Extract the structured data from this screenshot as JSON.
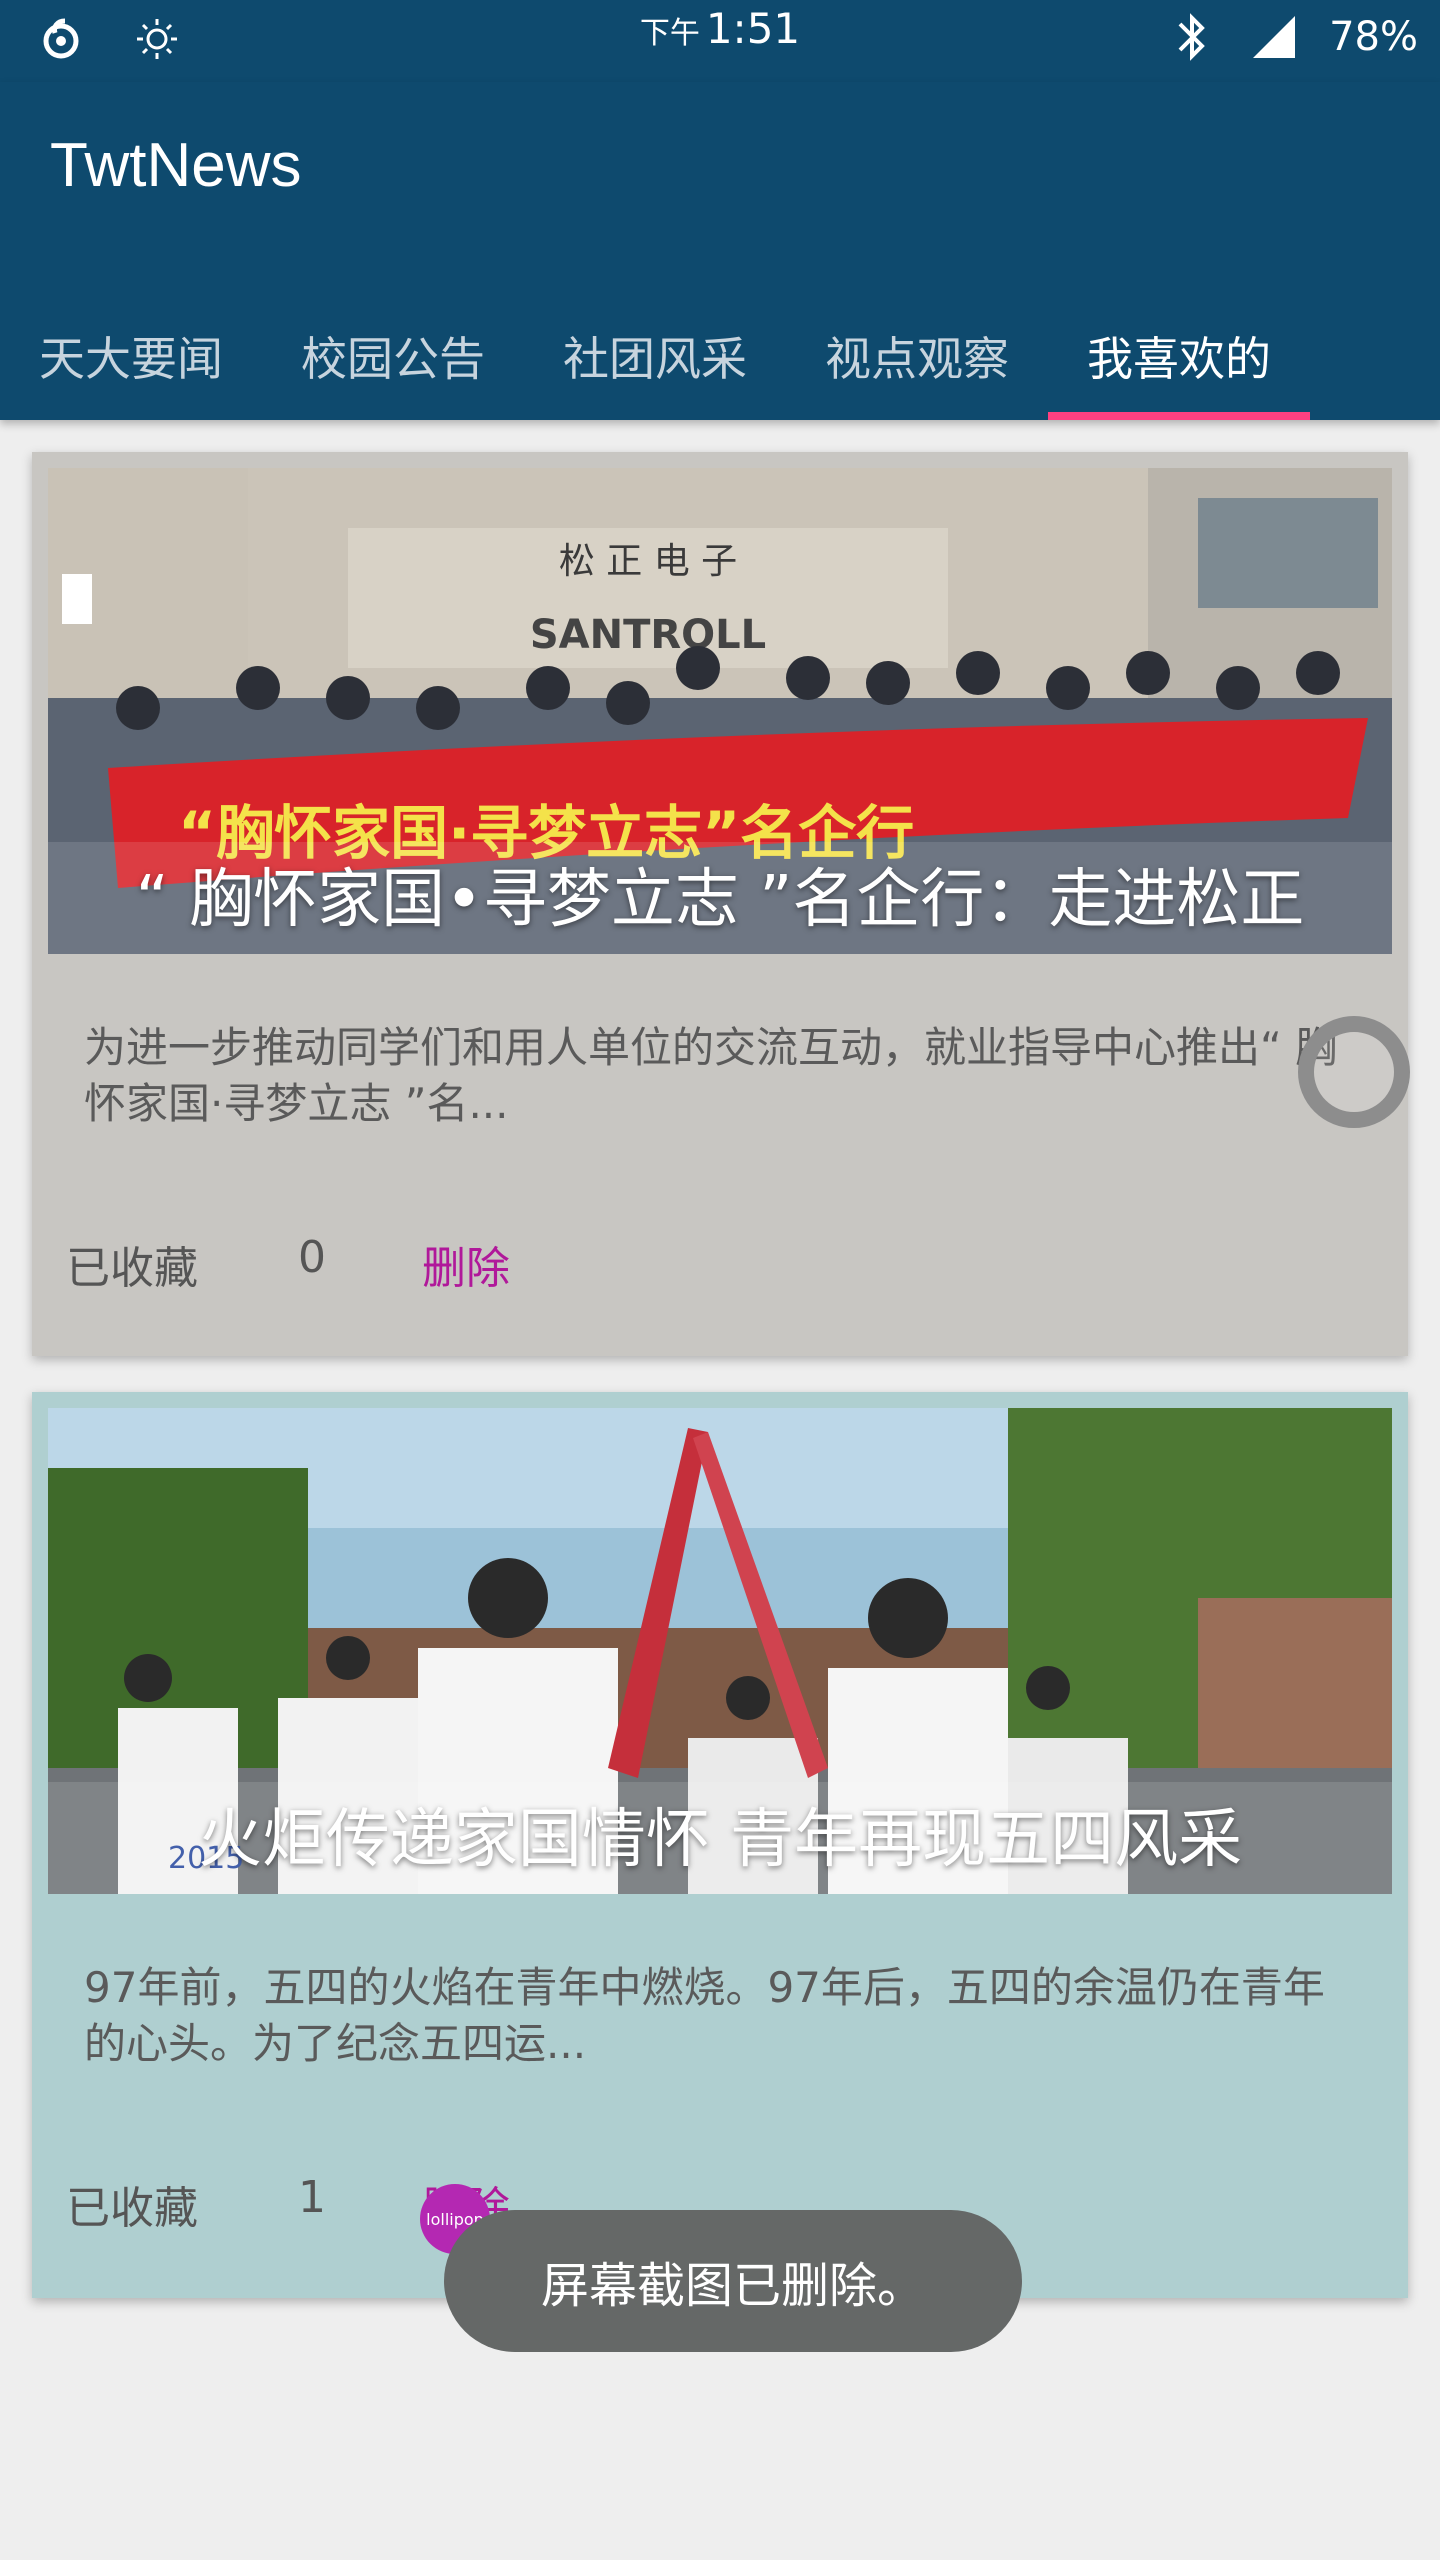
{
  "status_bar": {
    "ampm": "下午",
    "time": "1:51",
    "battery": "78%",
    "icons": [
      "netease-music-icon",
      "brightness-icon",
      "bluetooth-icon",
      "signal-icon"
    ]
  },
  "app_bar": {
    "title": "TwtNews",
    "color": "#0e4a6e"
  },
  "tabs": [
    {
      "label": "天大要闻"
    },
    {
      "label": "校园公告"
    },
    {
      "label": "社团风采"
    },
    {
      "label": "视点观察"
    },
    {
      "label": "我喜欢的"
    }
  ],
  "active_tab_index": 4,
  "accent_color": "#ff4081",
  "cards": [
    {
      "title": "“ 胸怀家国•寻梦立志 ”名企行：走进松正",
      "summary": "为进一步推动同学们和用人单位的交流互动，就业指导中心推出“ 胸怀家国·寻梦立志 ”名...",
      "favorite_label": "已收藏",
      "favorite_count": "0",
      "delete_label": "删除",
      "image": {
        "banner_text": "“胸怀家国·寻梦立志”名企行",
        "sign_text": "松 正 电 子",
        "sign_text_en": "SANTROLL"
      }
    },
    {
      "title": "火炬传递家国情怀  青年再现五四风采",
      "summary": "97年前，五四的火焰在青年中燃烧。97年后，五四的余温仍在青年的心头。为了纪念五四运...",
      "favorite_label": "已收藏",
      "favorite_count": "1",
      "delete_label": "删除",
      "image": {
        "shirt_text": "2015"
      }
    }
  ],
  "toast": {
    "text": "屏幕截图已删除。",
    "badge": "lollipop"
  }
}
